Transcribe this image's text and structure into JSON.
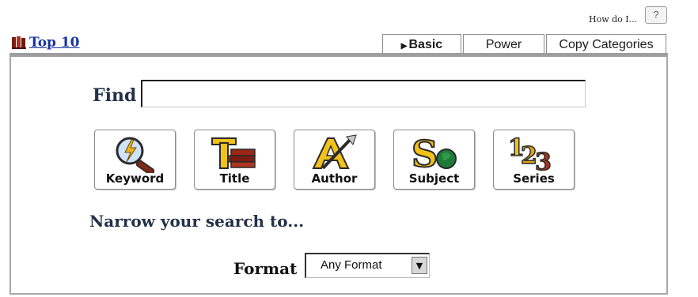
{
  "help": {
    "text": "How do I...",
    "button_label": "?"
  },
  "top10": {
    "label": "Top 10",
    "icon": "books-icon"
  },
  "tabs": [
    {
      "label": "Basic",
      "active": true
    },
    {
      "label": "Power",
      "active": false
    },
    {
      "label": "Copy Categories",
      "active": false
    }
  ],
  "search": {
    "label": "Find",
    "value": "",
    "placeholder": ""
  },
  "search_buttons": [
    {
      "label": "Keyword",
      "icon": "magnifier-lightning-icon"
    },
    {
      "label": "Title",
      "icon": "title-books-icon"
    },
    {
      "label": "Author",
      "icon": "author-quill-icon"
    },
    {
      "label": "Subject",
      "icon": "subject-s-icon"
    },
    {
      "label": "Series",
      "icon": "series-123-icon"
    }
  ],
  "narrow": {
    "heading": "Narrow your search to..."
  },
  "format": {
    "label": "Format",
    "selected": "Any Format"
  }
}
